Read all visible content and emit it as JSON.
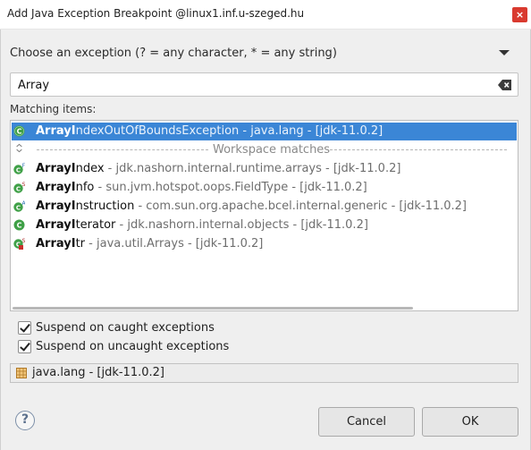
{
  "window": {
    "title": "Add Java Exception Breakpoint @linux1.inf.u-szeged.hu",
    "close_glyph": "×"
  },
  "prompt": "Choose an exception (? = any character, * = any string)",
  "search": {
    "value": "Array"
  },
  "matching_label": "Matching items:",
  "list": {
    "selected": {
      "icon": "class-icon",
      "bold": "ArrayI",
      "rest": "ndexOutOfBoundsException - java.lang - [jdk-11.0.2]"
    },
    "separator_label": "Workspace matches",
    "items": [
      {
        "icon": "final-class-icon",
        "bold": "ArrayI",
        "rest_dark": "ndex",
        "rest": " - jdk.nashorn.internal.runtime.arrays - [jdk-11.0.2]"
      },
      {
        "icon": "static-class-icon",
        "bold": "ArrayI",
        "rest_dark": "nfo",
        "rest": " - sun.jvm.hotspot.oops.FieldType - [jdk-11.0.2]"
      },
      {
        "icon": "abstract-class-icon",
        "bold": "ArrayI",
        "rest_dark": "nstruction",
        "rest": " - com.sun.org.apache.bcel.internal.generic - [jdk-11.0.2]"
      },
      {
        "icon": "class-icon",
        "bold": "ArrayI",
        "rest_dark": "terator",
        "rest": " - jdk.nashorn.internal.objects - [jdk-11.0.2]"
      },
      {
        "icon": "private-static-class-icon",
        "bold": "ArrayI",
        "rest_dark": "tr",
        "rest": " - java.util.Arrays - [jdk-11.0.2]"
      }
    ]
  },
  "options": {
    "caught": "Suspend on caught exceptions",
    "uncaught": "Suspend on uncaught exceptions"
  },
  "status": {
    "package": "java.lang - [jdk-11.0.2]"
  },
  "buttons": {
    "help": "?",
    "cancel": "Cancel",
    "ok": "OK"
  },
  "colors": {
    "selection": "#3b86d6",
    "class_icon": "#3fa047",
    "close": "#d93a2f"
  }
}
